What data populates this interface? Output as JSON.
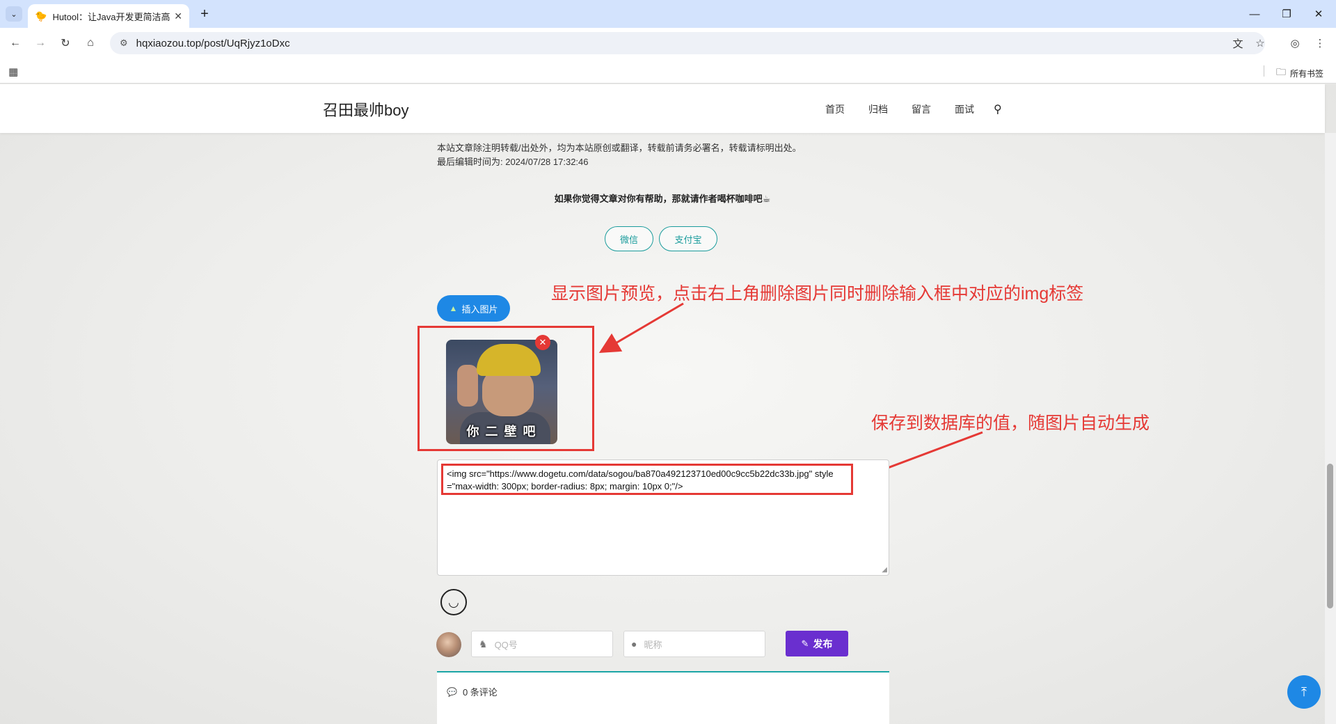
{
  "browser": {
    "tab_title": "Hutool：让Java开发更简洁高效",
    "tab_favicon": "🐤",
    "url": "hqxiaozou.top/post/UqRjyz1oDxc",
    "all_bookmarks": "所有书签"
  },
  "site": {
    "title": "召田最帅boy",
    "nav": [
      "首页",
      "归档",
      "留言",
      "面试"
    ]
  },
  "article": {
    "copyright_line": "本站文章除注明转载/出处外，均为本站原创或翻译，转载前请务必署名，转载请标明出处。",
    "edited_line": "最后编辑时间为: 2024/07/28 17:32:46",
    "donate_text": "如果你觉得文章对你有帮助，那就请作者喝杯咖啡吧☕",
    "pay_wechat": "微信",
    "pay_alipay": "支付宝"
  },
  "annotations": {
    "preview_note": "显示图片预览，点击右上角删除图片同时删除输入框中对应的img标签",
    "value_note": "保存到数据库的值，随图片自动生成"
  },
  "comment_form": {
    "insert_image_label": "插入图片",
    "preview_caption": "你 二 壁 吧",
    "textarea_value": "<img src=\"https://www.dogetu.com/data/sogou/ba870a492123710ed00c9cc5b22dc33b.jpg\" style=\"max-width: 300px; border-radius: 8px; margin: 10px 0;\"/>",
    "qq_placeholder": "QQ号",
    "nickname_placeholder": "昵称",
    "publish_label": "发布"
  },
  "comments": {
    "count_label": "0 条评论"
  },
  "colors": {
    "accent_blue": "#1e88e5",
    "annotation_red": "#e53935",
    "publish_purple": "#6a2fcf",
    "pay_teal": "#1a9c9c"
  }
}
